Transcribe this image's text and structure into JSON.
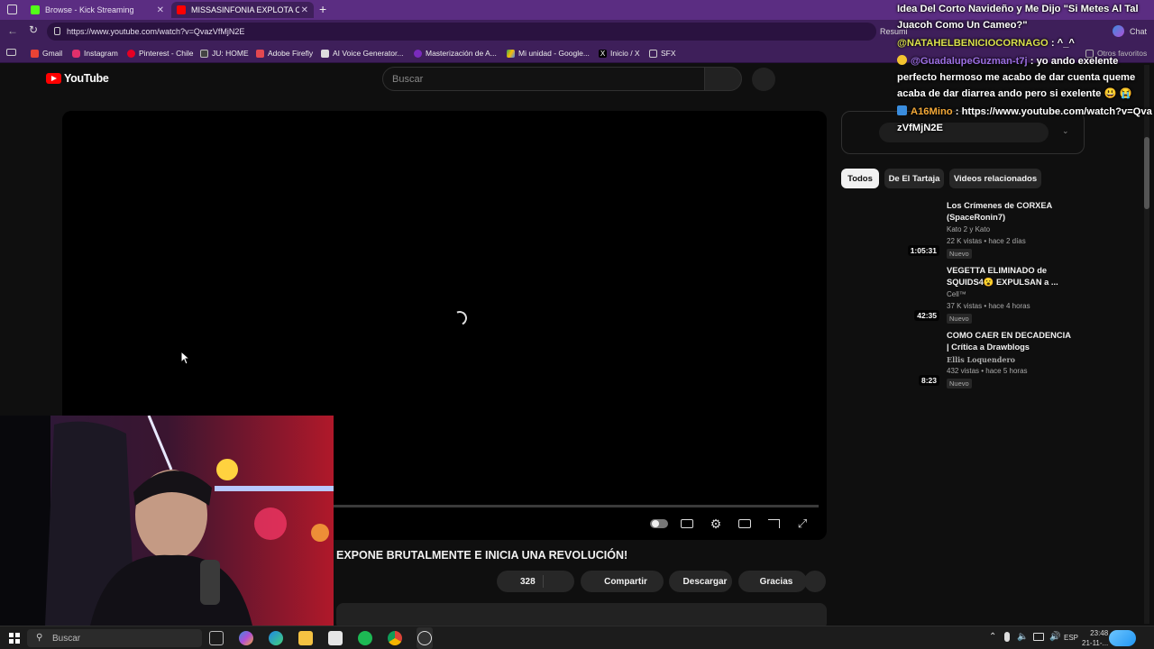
{
  "browser": {
    "tabs": [
      {
        "label": "Browse - Kick Streaming",
        "active": false,
        "icon": "kick-icon",
        "color": "#53fc18"
      },
      {
        "label": "MISSASINFONIA EXPLOTA CONT",
        "active": true,
        "icon": "youtube-icon",
        "color": "#ff0000"
      }
    ],
    "url": "https://www.youtube.com/watch?v=QvazVfMjN2E",
    "right_labels": {
      "resumir": "Resumi",
      "chat": "Chat",
      "otros": "Otros favoritos"
    },
    "bookmarks": [
      {
        "label": "Gmail",
        "color": "#ea4335"
      },
      {
        "label": "Instagram",
        "color": "#e1306c"
      },
      {
        "label": "Pinterest - Chile",
        "color": "#e60023"
      },
      {
        "label": "JU: HOME",
        "color": "#444444"
      },
      {
        "label": "Adobe Firefly",
        "color": "#e34850"
      },
      {
        "label": "AI Voice Generator...",
        "color": "#dddddd"
      },
      {
        "label": "Masterización de A...",
        "color": "#7a2bbd"
      },
      {
        "label": "Mi unidad - Google...",
        "color": "#34a853"
      },
      {
        "label": "Inicio / X",
        "color": "#000000"
      },
      {
        "label": "SFX",
        "color": "#cfcfcf"
      }
    ]
  },
  "youtube": {
    "logo_text": "YouTube",
    "search_placeholder": "Buscar",
    "video_title": "EXPONE BRUTALMENTE E INICIA UNA REVOLUCIÓN!",
    "actions": {
      "likes": "328",
      "share": "Compartir",
      "download": "Descargar",
      "thanks": "Gracias"
    },
    "chips": [
      {
        "label": "Todos",
        "active": true
      },
      {
        "label": "De El Tartaja",
        "active": false
      },
      {
        "label": "Videos relacionados",
        "active": false
      }
    ],
    "recommendations": [
      {
        "title": "Los Crímenes de  CORXEA (SpaceRonin7)",
        "channel": "Kato 2 y Kato",
        "meta": "22 K vistas • hace 2 días",
        "badge": "Nuevo",
        "duration": "1:05:31"
      },
      {
        "title": "VEGETTA ELIMINADO de SQUIDS4😮 EXPULSAN a ...",
        "channel": "Cell™",
        "meta": "37 K vistas • hace 4 horas",
        "badge": "Nuevo",
        "duration": "42:35"
      },
      {
        "title": "COMO CAER EN DECADENCIA | Crítica a Drawblogs",
        "channel": "Ellis Loquendero",
        "meta": "432 vistas • hace 5 horas",
        "badge": "Nuevo",
        "duration": "8:23"
      }
    ]
  },
  "chat": {
    "header": "Idea Del Corto Navideño y Me Dijo \"Si Metes Al Tal Juacoh Como Un Cameo?\"",
    "messages": [
      {
        "user": "@NATAHELBENICIOCORNAGO",
        "text": ": ^_^"
      },
      {
        "user": "@GuadalupeGuzman-t7j",
        "text": ": yo ando exelente perfecto hermoso me acabo de dar cuenta queme acaba de dar diarrea ando pero si exelente 😃 😭"
      },
      {
        "user": "A16Mino",
        "text": ": https://www.youtube.com/watch?v=QvazVfMjN2E"
      }
    ]
  },
  "taskbar": {
    "search_placeholder": "Buscar",
    "lang": "ESP",
    "time": "23:48",
    "date": "21-11-..."
  }
}
